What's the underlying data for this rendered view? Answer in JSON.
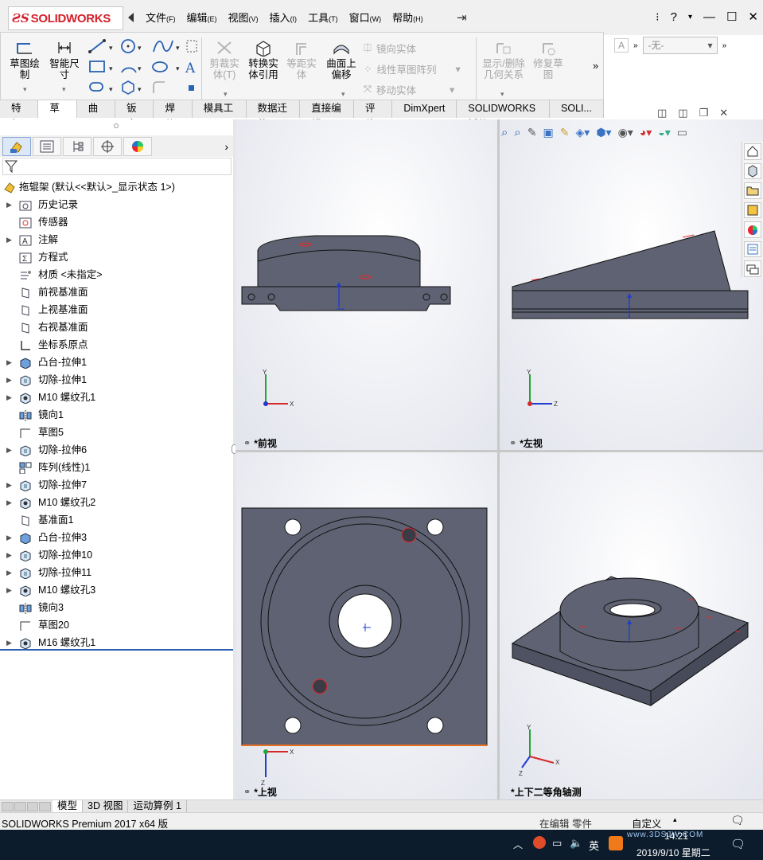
{
  "app": {
    "logo_ds": "ƧS",
    "logo_text": "SOLIDWORKS"
  },
  "menu": [
    {
      "label": "文件",
      "key": "(F)"
    },
    {
      "label": "编辑",
      "key": "(E)"
    },
    {
      "label": "视图",
      "key": "(V)"
    },
    {
      "label": "插入",
      "key": "(I)"
    },
    {
      "label": "工具",
      "key": "(T)"
    },
    {
      "label": "窗口",
      "key": "(W)"
    },
    {
      "label": "帮助",
      "key": "(H)"
    }
  ],
  "window_controls": {
    "help": "?",
    "minimize": "—",
    "maximize": "☐",
    "close": "✕"
  },
  "toolbar": {
    "sketch": "草图绘\n制",
    "smart_dim": "智能尺\n寸",
    "trim": "剪裁实\n体(T)",
    "convert": "转换实\n体引用",
    "offset": "等距实\n体",
    "offset_surface": "曲面上\n偏移",
    "mirror": "镜向实体",
    "linear_pattern": "线性草图阵列",
    "move": "移动实体",
    "show_relations": "显示/删除\n几何关系",
    "repair": "修复草\n图",
    "config_select": "-无-"
  },
  "cmd_tabs": [
    "特征",
    "草图",
    "曲面",
    "钣金",
    "焊件",
    "模具工具",
    "数据迁移",
    "直接编辑",
    "评估",
    "DimXpert",
    "SOLIDWORKS 插件",
    "SOLI..."
  ],
  "cmd_tab_active": 1,
  "tree": {
    "root": "拖辊架 (默认<<默认>_显示状态 1>)",
    "items": [
      {
        "label": "历史记录",
        "exp": true,
        "icon": "folder-history-icon"
      },
      {
        "label": "传感器",
        "exp": false,
        "icon": "sensor-icon"
      },
      {
        "label": "注解",
        "exp": true,
        "icon": "annotation-icon"
      },
      {
        "label": "方程式",
        "exp": false,
        "icon": "equation-icon"
      },
      {
        "label": "材质 <未指定>",
        "exp": false,
        "icon": "material-icon"
      },
      {
        "label": "前视基准面",
        "exp": false,
        "icon": "plane-icon"
      },
      {
        "label": "上视基准面",
        "exp": false,
        "icon": "plane-icon"
      },
      {
        "label": "右视基准面",
        "exp": false,
        "icon": "plane-icon"
      },
      {
        "label": "坐标系原点",
        "exp": false,
        "icon": "origin-icon"
      },
      {
        "label": "凸台-拉伸1",
        "exp": true,
        "icon": "boss-extrude-icon"
      },
      {
        "label": "切除-拉伸1",
        "exp": true,
        "icon": "cut-extrude-icon"
      },
      {
        "label": "M10 螺纹孔1",
        "exp": true,
        "icon": "hole-wizard-icon"
      },
      {
        "label": "镜向1",
        "exp": false,
        "icon": "mirror-icon"
      },
      {
        "label": "草图5",
        "exp": false,
        "icon": "sketch-icon"
      },
      {
        "label": "切除-拉伸6",
        "exp": true,
        "icon": "cut-extrude-icon"
      },
      {
        "label": "阵列(线性)1",
        "exp": false,
        "icon": "linear-pattern-icon"
      },
      {
        "label": "切除-拉伸7",
        "exp": true,
        "icon": "cut-extrude-icon"
      },
      {
        "label": "M10 螺纹孔2",
        "exp": true,
        "icon": "hole-wizard-icon"
      },
      {
        "label": "基准面1",
        "exp": false,
        "icon": "plane-icon"
      },
      {
        "label": "凸台-拉伸3",
        "exp": true,
        "icon": "boss-extrude-icon"
      },
      {
        "label": "切除-拉伸10",
        "exp": true,
        "icon": "cut-extrude-icon"
      },
      {
        "label": "切除-拉伸11",
        "exp": true,
        "icon": "cut-extrude-icon"
      },
      {
        "label": "M10 螺纹孔3",
        "exp": true,
        "icon": "hole-wizard-icon"
      },
      {
        "label": "镜向3",
        "exp": false,
        "icon": "mirror-icon"
      },
      {
        "label": "草图20",
        "exp": false,
        "icon": "sketch-icon"
      },
      {
        "label": "M16 螺纹孔1",
        "exp": true,
        "icon": "hole-wizard-icon"
      }
    ]
  },
  "views": {
    "front": "*前视",
    "left": "*左视",
    "top": "*上视",
    "iso": "*上下二等角轴测"
  },
  "axes": {
    "x": "X",
    "y": "Y",
    "z": "Z"
  },
  "bottom_tabs": [
    "模型",
    "3D 视图",
    "运动算例 1"
  ],
  "status": {
    "product": "SOLIDWORKS Premium 2017 x64 版",
    "editing": "在编辑 零件",
    "custom": "自定义"
  },
  "taskbar": {
    "time": "14:21",
    "date": "2019/9/10 星期二",
    "ime": "英",
    "watermark": "www.3DSJW.COM"
  },
  "colors": {
    "model": "#5f6272",
    "accent": "#d4202a",
    "highlight": "#e8282a"
  }
}
